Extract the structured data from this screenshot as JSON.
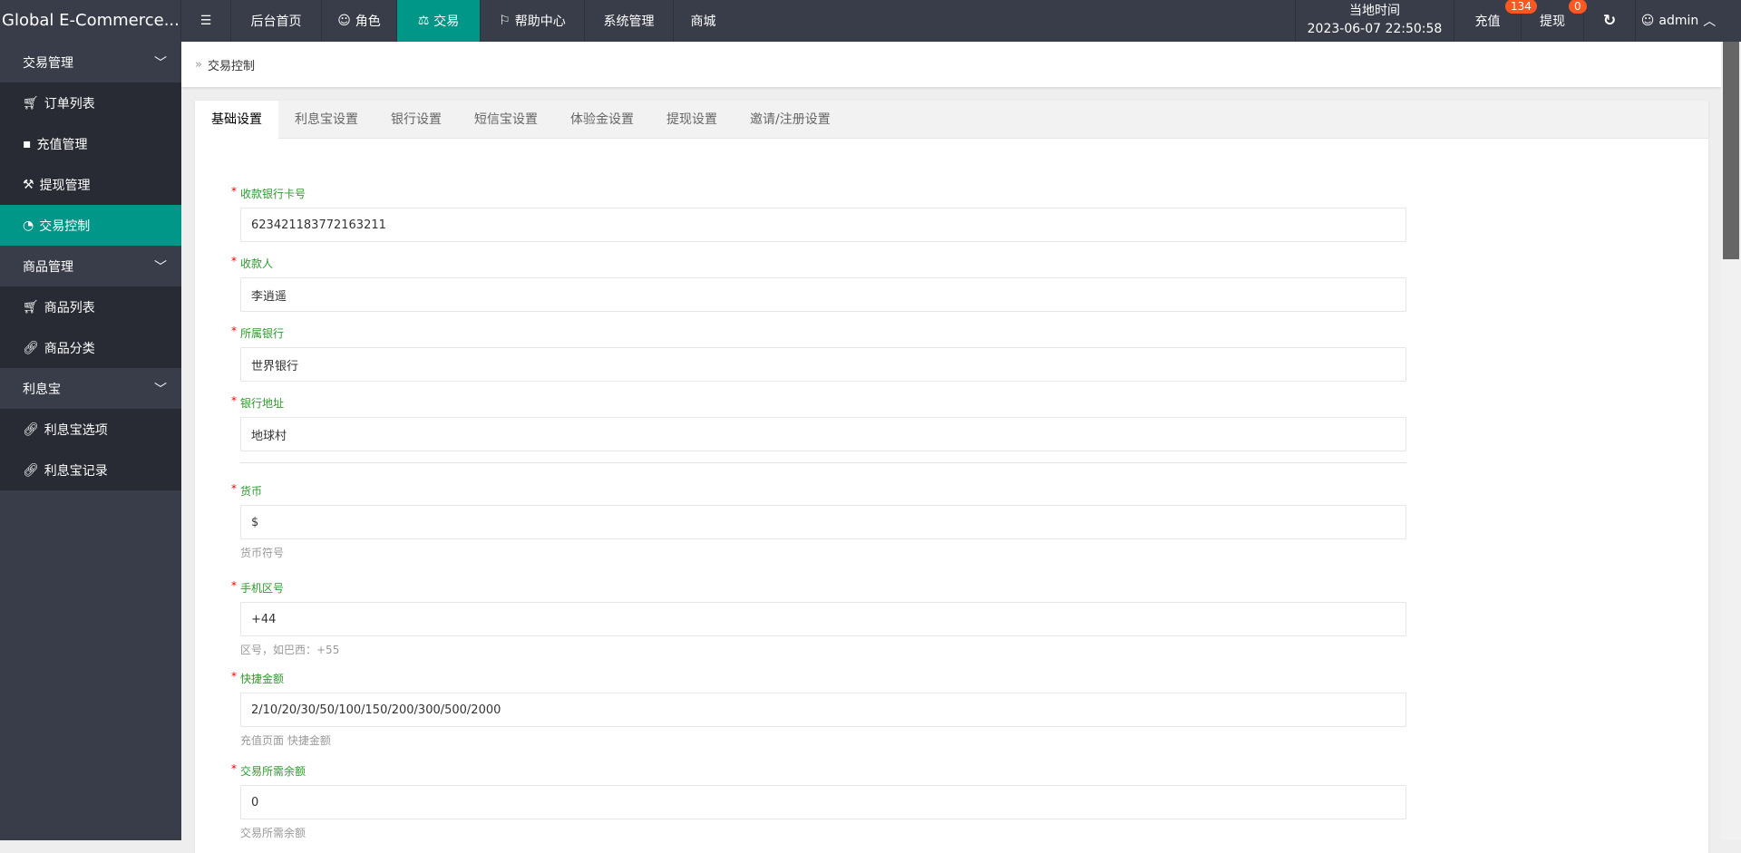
{
  "app": {
    "title": "Global E-Commerce..."
  },
  "topnav": {
    "items": [
      {
        "label": "后台首页",
        "icon": ""
      },
      {
        "label": "角色",
        "icon": "user-icon"
      },
      {
        "label": "交易",
        "icon": "scale-icon"
      },
      {
        "label": "帮助中心",
        "icon": "flag-icon"
      },
      {
        "label": "系统管理",
        "icon": ""
      },
      {
        "label": "商城",
        "icon": ""
      }
    ],
    "time_label": "当地时间",
    "time_value": "2023-06-07 22:50:58",
    "recharge": "充值",
    "recharge_badge": "134",
    "withdraw": "提现",
    "withdraw_badge": "0",
    "user": "admin"
  },
  "sidebar": {
    "groups": [
      {
        "label": "交易管理",
        "items": [
          {
            "label": "订单列表",
            "icon": "cart-icon"
          },
          {
            "label": "充值管理",
            "icon": "clipboard-icon"
          },
          {
            "label": "提现管理",
            "icon": "hammer-icon"
          },
          {
            "label": "交易控制",
            "icon": "dashboard-icon"
          }
        ]
      },
      {
        "label": "商品管理",
        "items": [
          {
            "label": "商品列表",
            "icon": "cart-icon"
          },
          {
            "label": "商品分类",
            "icon": "link-icon"
          }
        ]
      },
      {
        "label": "利息宝",
        "items": [
          {
            "label": "利息宝选项",
            "icon": "link-icon"
          },
          {
            "label": "利息宝记录",
            "icon": "link-icon"
          }
        ]
      }
    ]
  },
  "breadcrumb": "交易控制",
  "tabs": [
    "基础设置",
    "利息宝设置",
    "银行设置",
    "短信宝设置",
    "体验金设置",
    "提现设置",
    "邀请/注册设置"
  ],
  "form": [
    {
      "label": "收款银行卡号",
      "value": "6234211837721632​11",
      "help": ""
    },
    {
      "label": "收款人",
      "value": "李逍遥",
      "help": ""
    },
    {
      "label": "所属银行",
      "value": "世界银行",
      "help": ""
    },
    {
      "label": "银行地址",
      "value": "地球村",
      "help": ""
    },
    {
      "label": "货币",
      "value": "$",
      "help": "货币符号"
    },
    {
      "label": "手机区号",
      "value": "+44",
      "help": "区号，如巴西：+55"
    },
    {
      "label": "快捷金额",
      "value": "2/10/20/30/50/100/150/200/300/500/2000",
      "help": "充值页面 快捷金额"
    },
    {
      "label": "交易所需余额",
      "value": "0",
      "help": "交易所需余额"
    }
  ],
  "colors": {
    "accent": "#009688",
    "topbar": "#393d49",
    "badge": "#ff5722",
    "label": "#2e9a2e"
  }
}
